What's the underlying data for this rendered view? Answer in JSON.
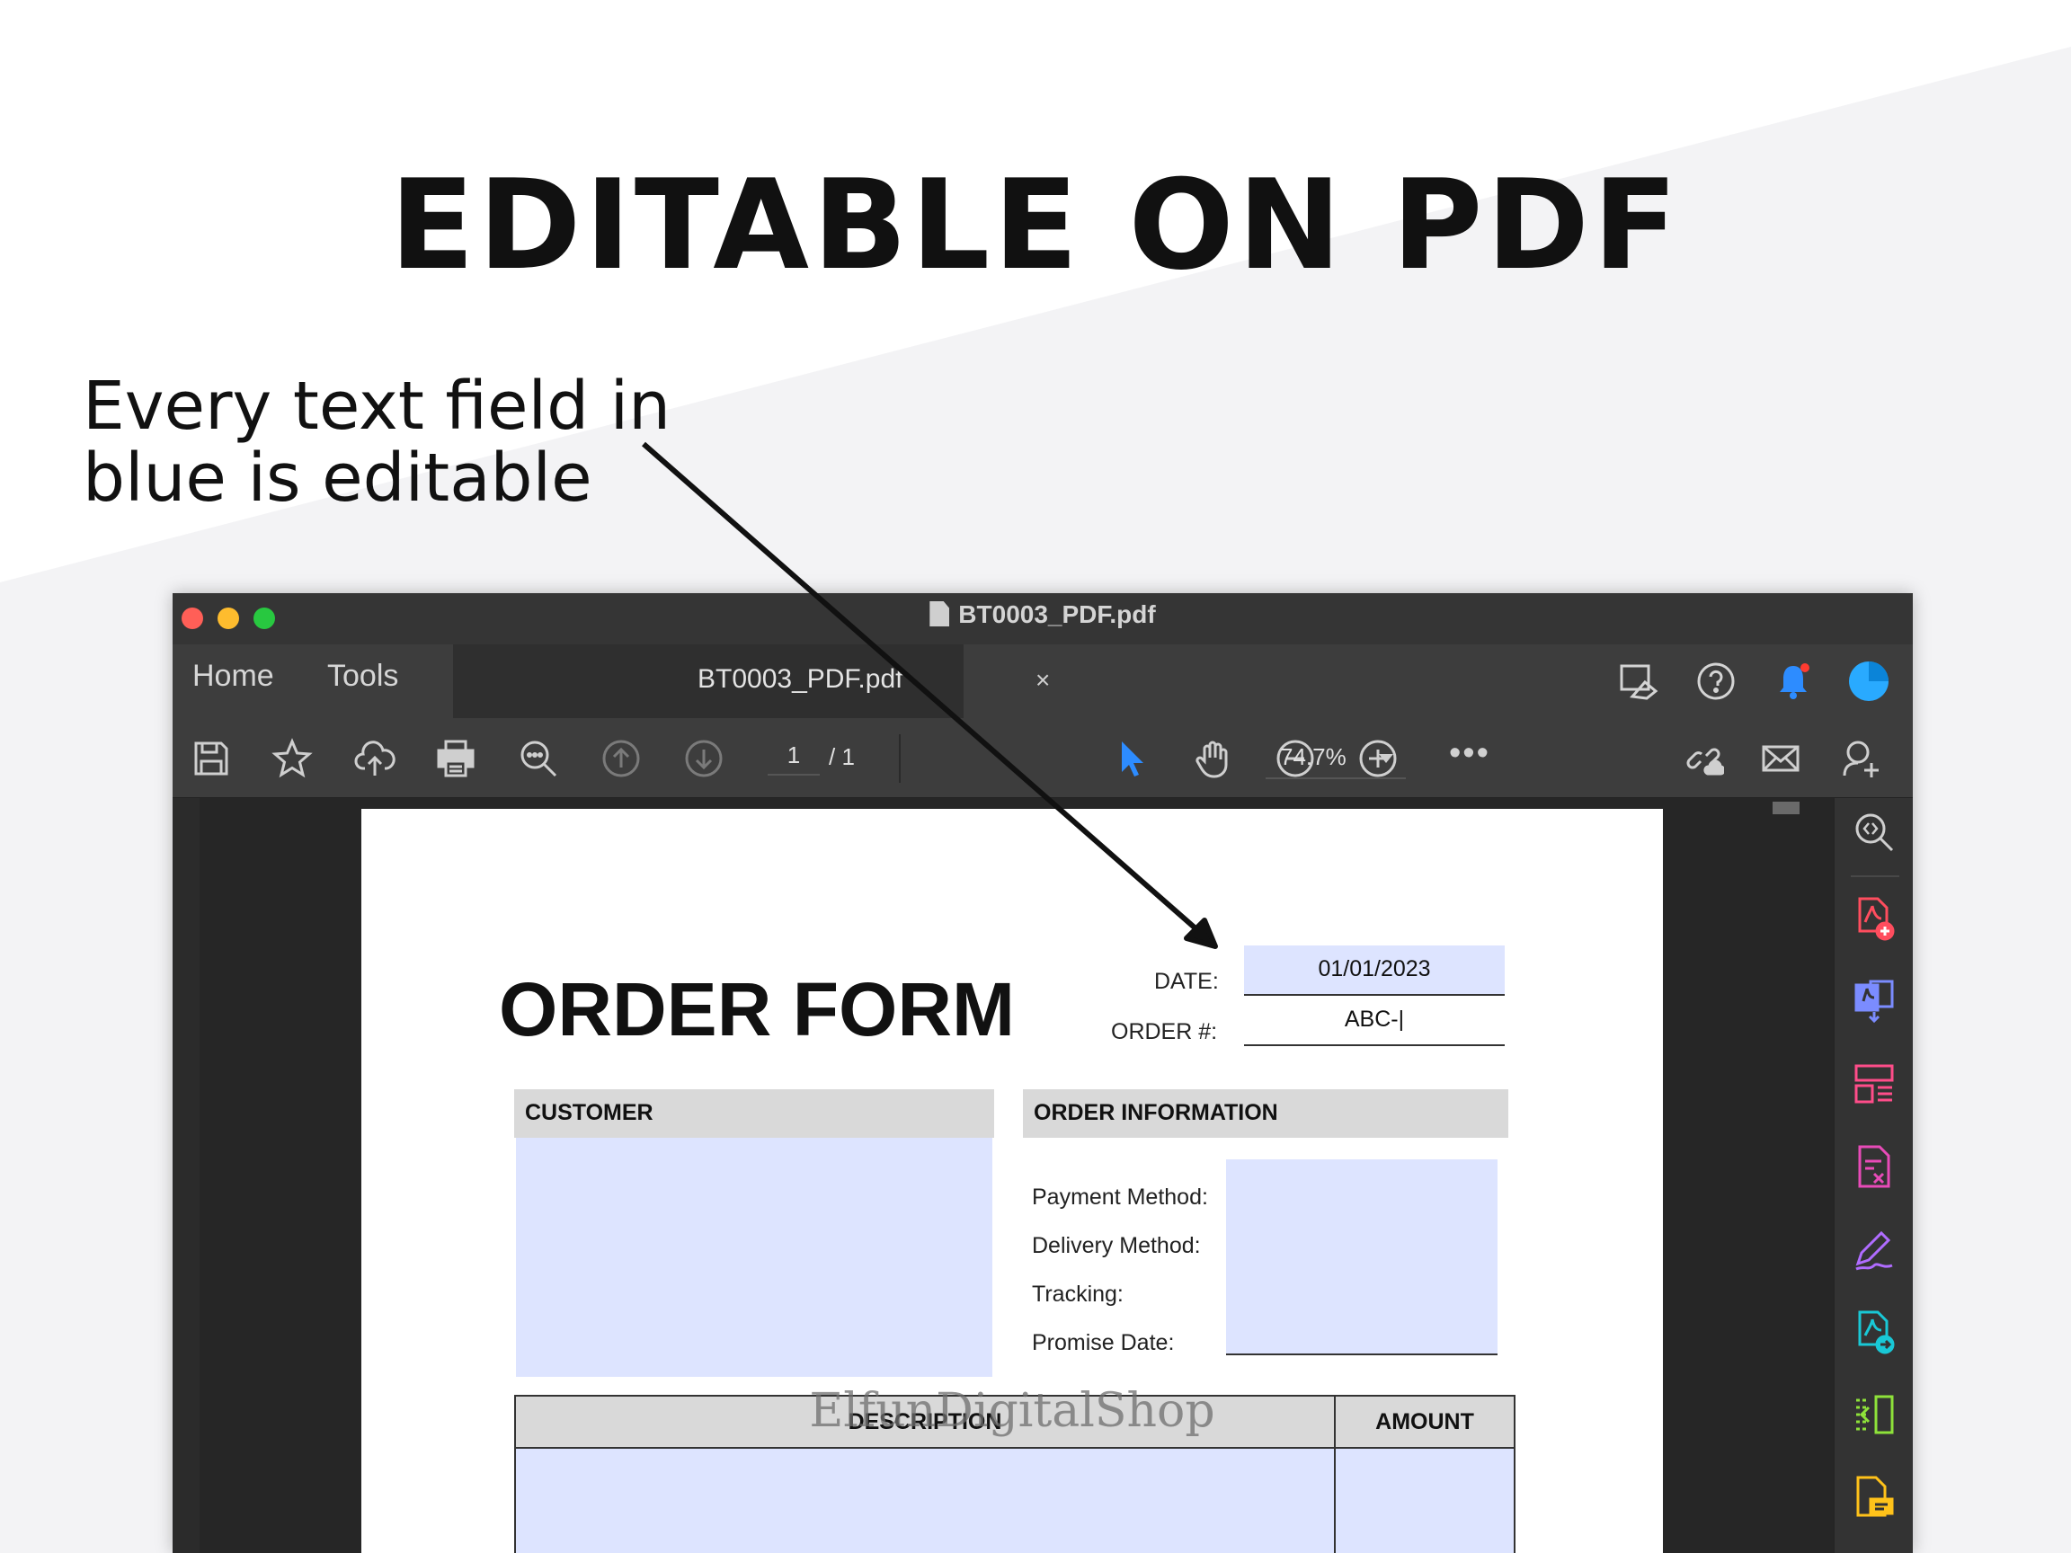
{
  "headline": "EDITABLE ON PDF",
  "callout": "Every text field in\nblue is editable",
  "window": {
    "title": "BT0003_PDF.pdf",
    "tabs": {
      "home": "Home",
      "tools": "Tools",
      "doc": "BT0003_PDF.pdf",
      "close": "×"
    },
    "toolbar": {
      "page_current": "1",
      "page_total": "/ 1",
      "zoom": "74.7%",
      "more": "•••",
      "icons": [
        "save-icon",
        "star-icon",
        "cloud-upload-icon",
        "print-icon",
        "zoom-search-icon",
        "page-up-icon",
        "page-down-icon",
        "select-cursor-icon",
        "hand-icon",
        "zoom-out-icon",
        "zoom-in-icon",
        "share-link-icon",
        "email-icon",
        "add-user-icon"
      ]
    },
    "top_icons": [
      "share-screen-icon",
      "help-icon",
      "notification-bell-icon",
      "account-avatar"
    ],
    "rail_icons": [
      "zoom-rail-icon",
      "create-pdf-icon",
      "export-pdf-icon",
      "organize-pages-icon",
      "edit-pdf-icon",
      "fill-sign-icon",
      "share-pdf-icon",
      "compress-icon",
      "comment-icon"
    ],
    "colors": {
      "accent_blue": "#2d8cff",
      "traffic_red": "#ff5f57",
      "traffic_yellow": "#febc2e",
      "traffic_green": "#28c840",
      "field_blue": "#dde4ff"
    }
  },
  "form": {
    "title": "ORDER FORM",
    "date_label": "DATE:",
    "date_value": "01/01/2023",
    "order_label": "ORDER #:",
    "order_value": "ABC-|",
    "customer_head": "CUSTOMER",
    "order_info_head": "ORDER INFORMATION",
    "payment_label": "Payment Method:",
    "delivery_label": "Delivery Method:",
    "tracking_label": "Tracking:",
    "promise_label": "Promise Date:",
    "description_head": "DESCRIPTION",
    "amount_head": "AMOUNT"
  },
  "watermark": "ElfunDigitalShop"
}
